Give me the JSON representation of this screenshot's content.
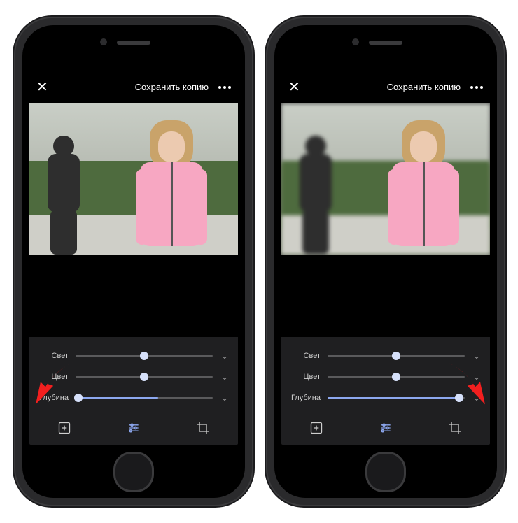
{
  "header": {
    "close_label": "✕",
    "save_label": "Сохранить копию",
    "more_label": "•••"
  },
  "sliders": {
    "light": {
      "label": "Свет",
      "value": 50
    },
    "color": {
      "label": "Цвет",
      "value": 50
    },
    "depth_left": {
      "label": "Глубина",
      "value": 2
    },
    "depth_right": {
      "label": "Глубина",
      "value": 96
    }
  },
  "bottombar": {
    "suggest": "suggest-icon",
    "adjust": "adjust-icon",
    "crop": "crop-icon"
  },
  "colors": {
    "accent": "#8da8f0",
    "arrow": "#f21f1f"
  }
}
